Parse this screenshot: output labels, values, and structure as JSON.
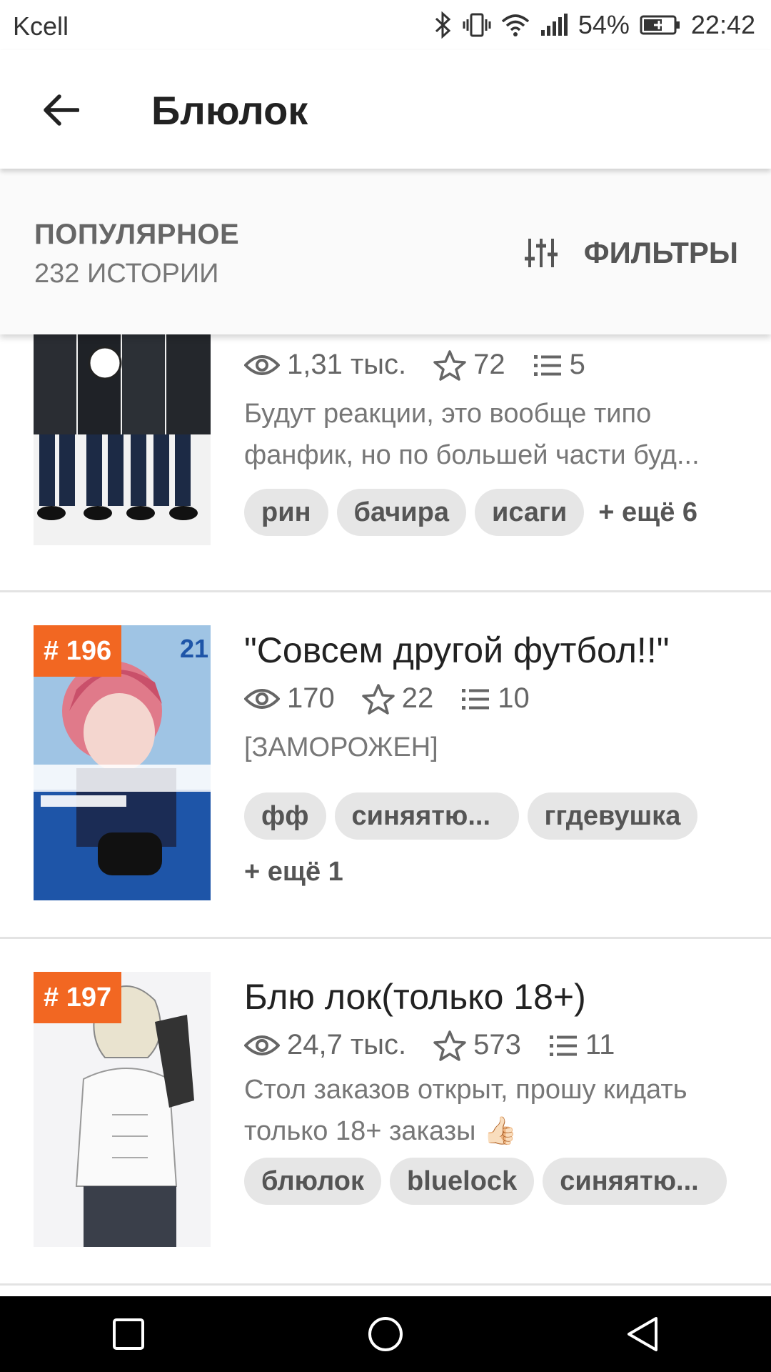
{
  "status_bar": {
    "carrier": "Kcell",
    "battery_percent": "54%",
    "time": "22:42"
  },
  "app_bar": {
    "title": "Блюлок"
  },
  "sort_header": {
    "title": "ПОПУЛЯРНОЕ",
    "count": "232 ИСТОРИИ",
    "filters_label": "ФИЛЬТРЫ"
  },
  "stories": [
    {
      "rank": "",
      "title": "",
      "views": "1,31 тыс.",
      "votes": "72",
      "parts": "5",
      "description_lines": [
        "Будут реакции, это вообще типо",
        "фанфик, но по большей части буд..."
      ],
      "tags": [
        "рин",
        "бачира",
        "исаги"
      ],
      "more_tags": "+ ещё 6"
    },
    {
      "rank": "# 196",
      "title": "\"Совсем другой футбол!!\"",
      "views": "170",
      "votes": "22",
      "parts": "10",
      "description_lines": [
        "[ЗАМОРОЖЕН]"
      ],
      "tags": [
        "фф",
        "синяятю...",
        "ггдевушка"
      ],
      "more_tags": "+ ещё 1"
    },
    {
      "rank": "# 197",
      "title": "Блю лок(только 18+)",
      "views": "24,7 тыс.",
      "votes": "573",
      "parts": "11",
      "description_lines": [
        "Стол заказов открыт, прошу кидать",
        "только 18+ заказы 👍🏻"
      ],
      "tags": [
        "блюлок",
        "bluelock",
        "синяятю..."
      ],
      "more_tags": ""
    }
  ],
  "colors": {
    "rank_badge": "#f26722",
    "tag_bg": "#e6e6e6",
    "navbar_bg": "#000000"
  }
}
